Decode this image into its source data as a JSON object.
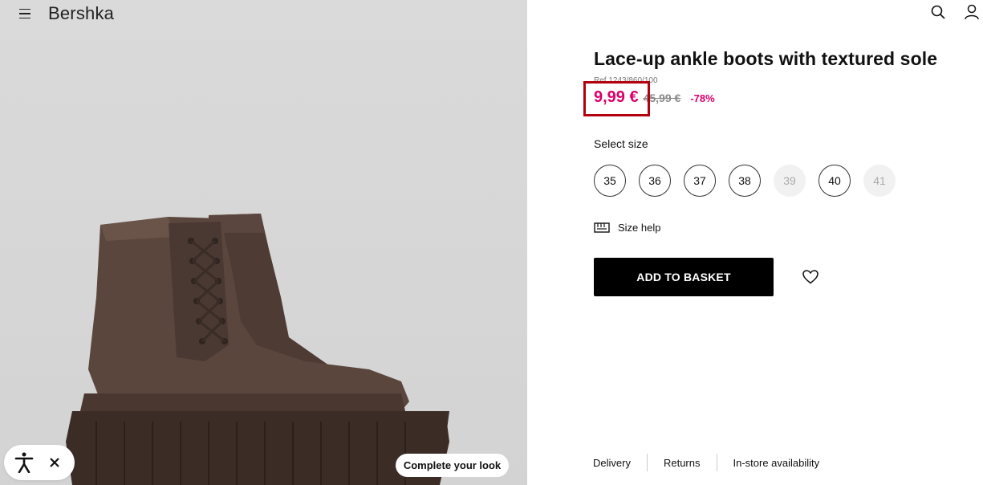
{
  "header": {
    "brand": "Bershka",
    "menu_icon": "hamburger-menu-icon",
    "search_icon": "search-icon",
    "account_icon": "user-icon"
  },
  "product": {
    "title": "Lace-up ankle boots with textured sole",
    "ref": "Ref 1243/860/100",
    "price_current": "9,99 €",
    "price_original": "45,99 €",
    "discount": "-78%",
    "price_color": "#d9006c"
  },
  "sizes": {
    "label": "Select size",
    "options": [
      {
        "label": "35",
        "available": true
      },
      {
        "label": "36",
        "available": true
      },
      {
        "label": "37",
        "available": true
      },
      {
        "label": "38",
        "available": true
      },
      {
        "label": "39",
        "available": false
      },
      {
        "label": "40",
        "available": true
      },
      {
        "label": "41",
        "available": false
      }
    ]
  },
  "size_help": {
    "label": "Size help",
    "icon": "ruler-icon"
  },
  "actions": {
    "add_to_basket": "ADD TO BASKET",
    "wishlist_icon": "heart-icon"
  },
  "overlay": {
    "accessibility_icon": "accessibility-icon",
    "close_icon": "close-icon",
    "complete_look": "Complete your look"
  },
  "footer": {
    "links": [
      "Delivery",
      "Returns",
      "In-store availability"
    ]
  }
}
